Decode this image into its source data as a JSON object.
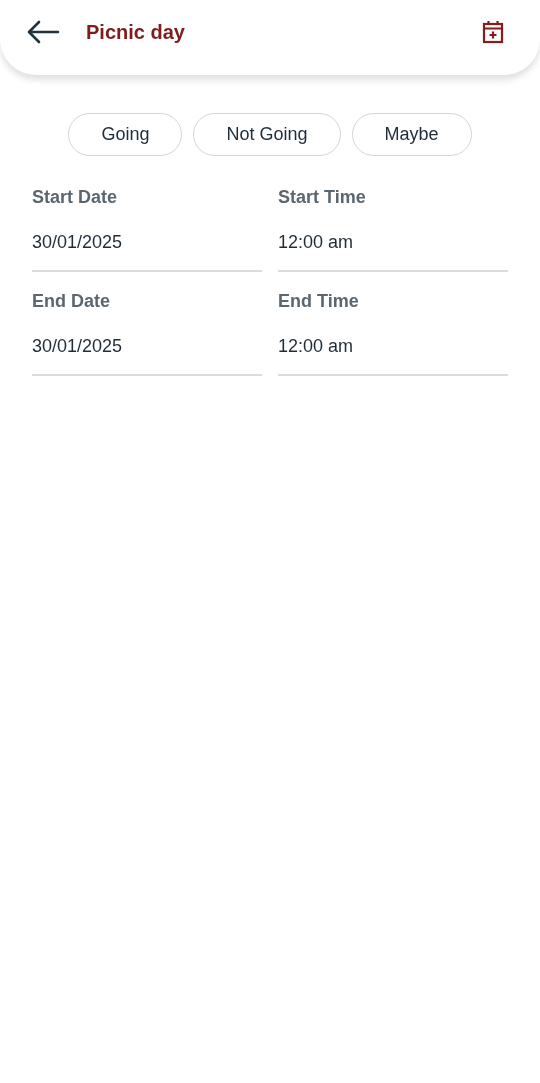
{
  "header": {
    "title": "Picnic day"
  },
  "rsvp_options": [
    {
      "label": "Going",
      "selected": false
    },
    {
      "label": "Not Going",
      "selected": false
    },
    {
      "label": "Maybe",
      "selected": false
    }
  ],
  "fields": [
    {
      "label": "Start Date",
      "value": "30/01/2025"
    },
    {
      "label": "Start Time",
      "value": "12:00 am"
    },
    {
      "label": "End Date",
      "value": "30/01/2025"
    },
    {
      "label": "End Time",
      "value": "12:00 am"
    }
  ]
}
